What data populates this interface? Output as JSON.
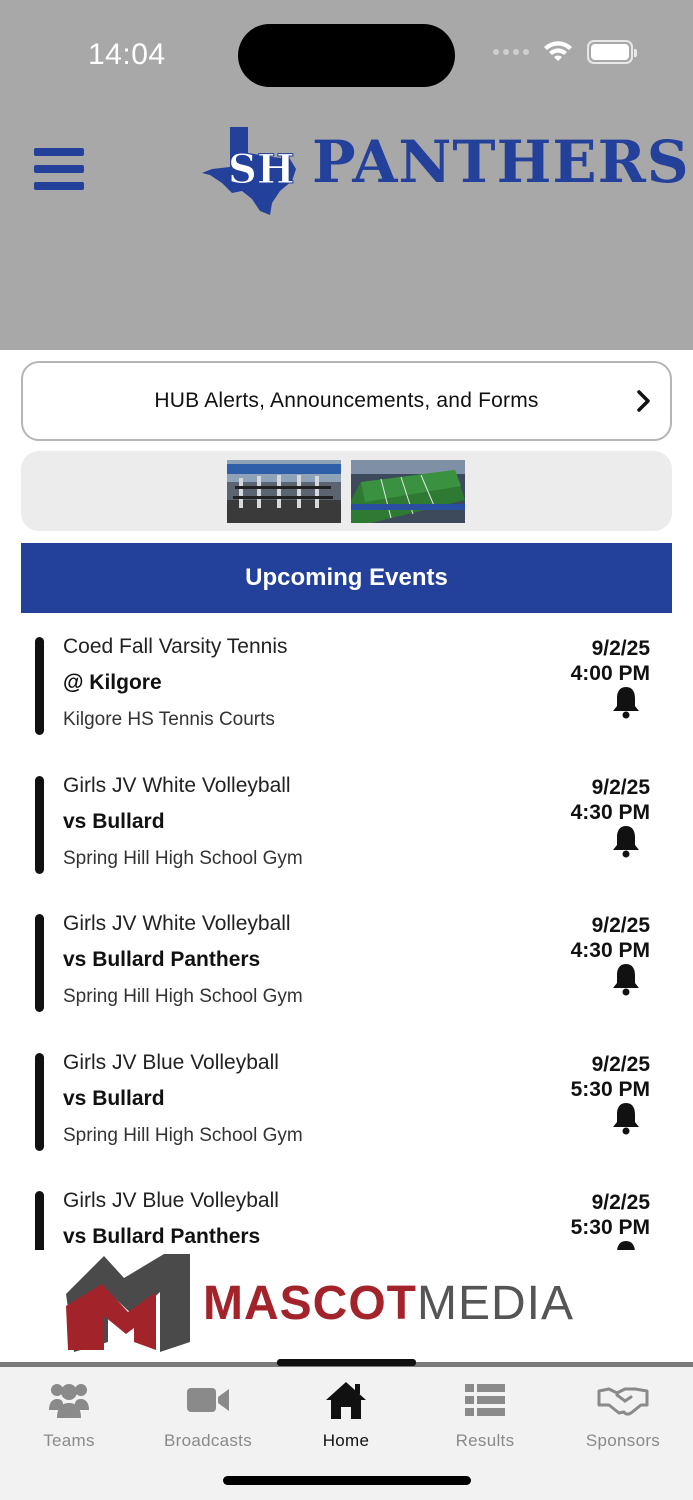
{
  "status_bar": {
    "time": "14:04"
  },
  "header": {
    "logo_text": "PANTHERS",
    "logo_monogram": "SH"
  },
  "hub": {
    "label": "HUB Alerts, Announcements, and Forms"
  },
  "events": {
    "title": "Upcoming Events",
    "items": [
      {
        "team": "Coed Fall Varsity Tennis",
        "opponent": "@ Kilgore",
        "location": "Kilgore HS Tennis Courts",
        "date": "9/2/25",
        "time": "4:00 PM"
      },
      {
        "team": "Girls JV White Volleyball",
        "opponent": "vs Bullard",
        "location": "Spring Hill High School Gym",
        "date": "9/2/25",
        "time": "4:30 PM"
      },
      {
        "team": "Girls JV White Volleyball",
        "opponent": "vs Bullard Panthers",
        "location": "Spring Hill High School Gym",
        "date": "9/2/25",
        "time": "4:30 PM"
      },
      {
        "team": "Girls JV Blue Volleyball",
        "opponent": "vs Bullard",
        "location": "Spring Hill High School Gym",
        "date": "9/2/25",
        "time": "5:30 PM"
      },
      {
        "team": "Girls JV Blue Volleyball",
        "opponent": "vs Bullard Panthers",
        "location": "",
        "date": "9/2/25",
        "time": "5:30 PM"
      }
    ]
  },
  "sponsor_banner": {
    "word1": "MASCOT",
    "word2": "MEDIA"
  },
  "tabs": [
    {
      "label": "Teams",
      "icon": "users-icon"
    },
    {
      "label": "Broadcasts",
      "icon": "video-camera-icon"
    },
    {
      "label": "Home",
      "icon": "home-icon",
      "active": true
    },
    {
      "label": "Results",
      "icon": "list-icon"
    },
    {
      "label": "Sponsors",
      "icon": "handshake-icon"
    }
  ],
  "colors": {
    "brand_blue": "#23409a",
    "header_gray": "#a8a8a8",
    "mascot_red": "#a3232b"
  }
}
